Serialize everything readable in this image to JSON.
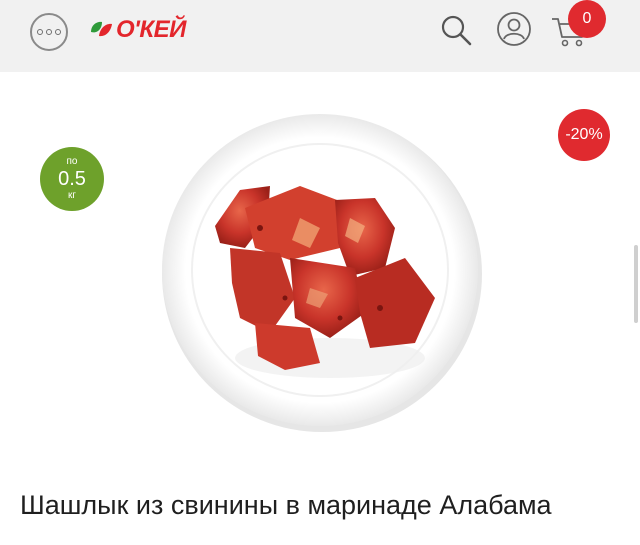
{
  "header": {
    "logo_text": "О'КЕЙ",
    "cart_count": "0",
    "icons": {
      "menu": "more-icon",
      "search": "search-icon",
      "profile": "user-icon",
      "cart": "cart-icon"
    }
  },
  "product": {
    "weight_prefix": "по",
    "weight_value": "0.5",
    "weight_unit": "кг",
    "discount": "-20%",
    "title": "Шашлык из свинины в маринаде Алабама"
  },
  "colors": {
    "brand_red": "#e3262c",
    "badge_red": "#e02a2f",
    "weight_green": "#6ea12b",
    "header_bg": "#f1f1f1"
  }
}
